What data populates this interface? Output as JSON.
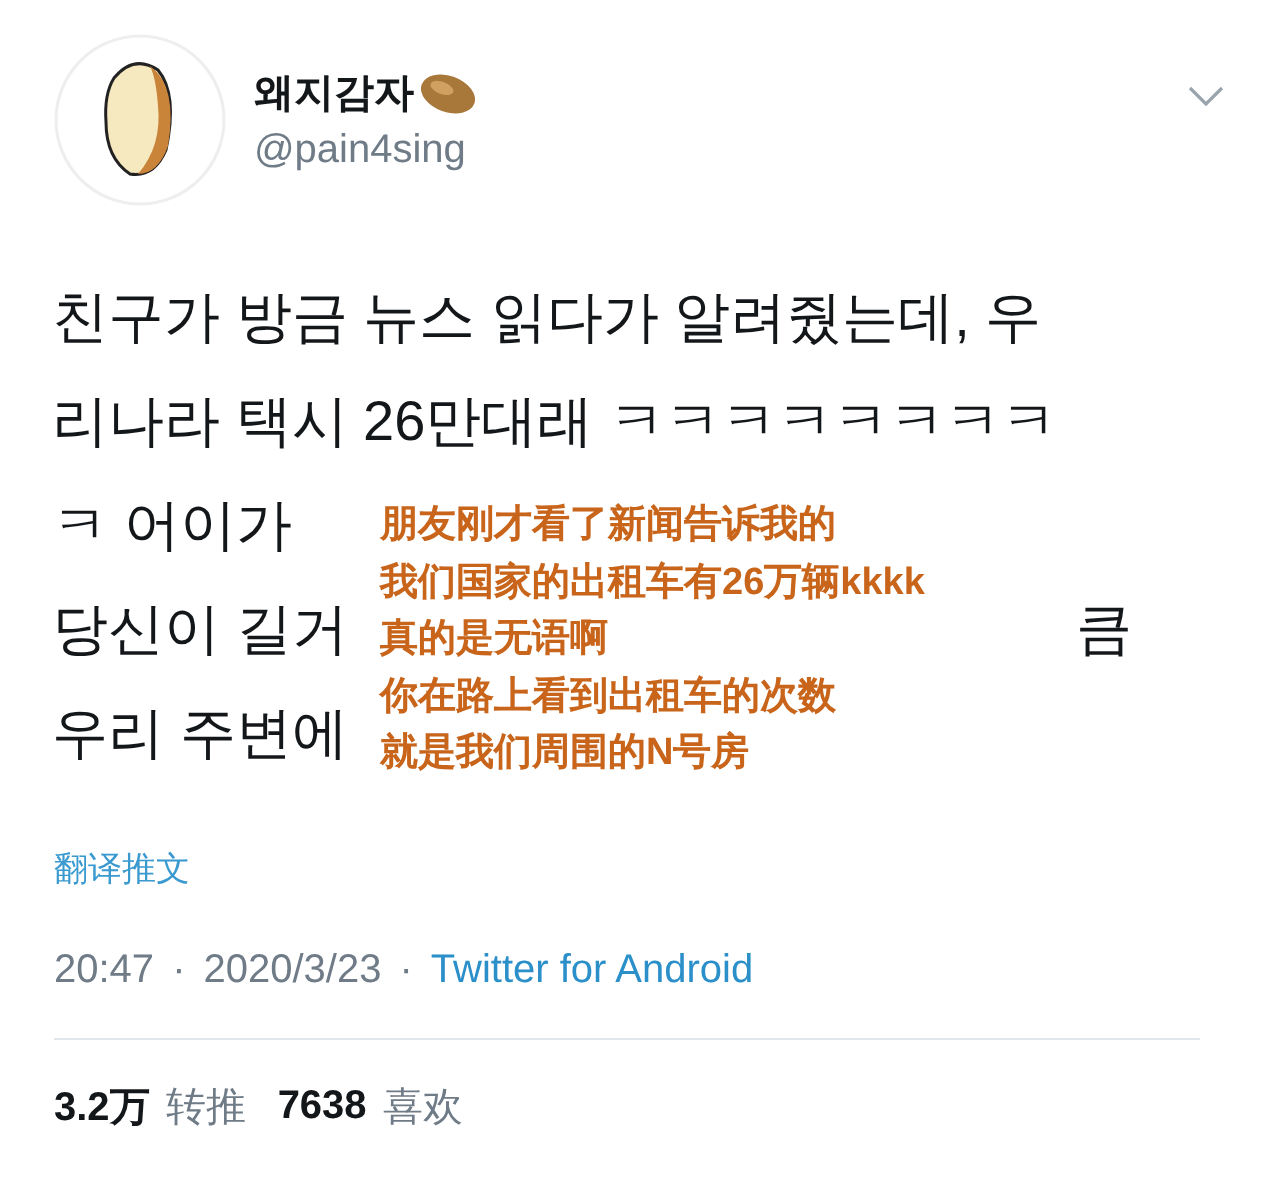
{
  "author": {
    "name": "왜지감자",
    "handle": "@pain4sing"
  },
  "tweet_lines": [
    {
      "left": "친구가 방금 뉴스 읽다가 알려줬는데, 우"
    },
    {
      "left": "리나라 택시 26만대래 ㅋㅋㅋㅋㅋㅋㅋㅋ"
    },
    {
      "left": "ㅋ 어이가"
    },
    {
      "left": "당신이 길거",
      "right": "큼"
    },
    {
      "left": "우리 주변에"
    }
  ],
  "translation_overlay": [
    "朋友刚才看了新闻告诉我的",
    "我们国家的出租车有26万辆kkkk",
    "真的是无语啊",
    "你在路上看到出租车的次数",
    "就是我们周围的N号房"
  ],
  "translate_link": "翻译推文",
  "meta": {
    "time": "20:47",
    "date": "2020/3/23",
    "separator": "·",
    "source": "Twitter for Android"
  },
  "stats": [
    {
      "count": "3.2万",
      "label": "转推"
    },
    {
      "count": "7638",
      "label": "喜欢"
    }
  ]
}
